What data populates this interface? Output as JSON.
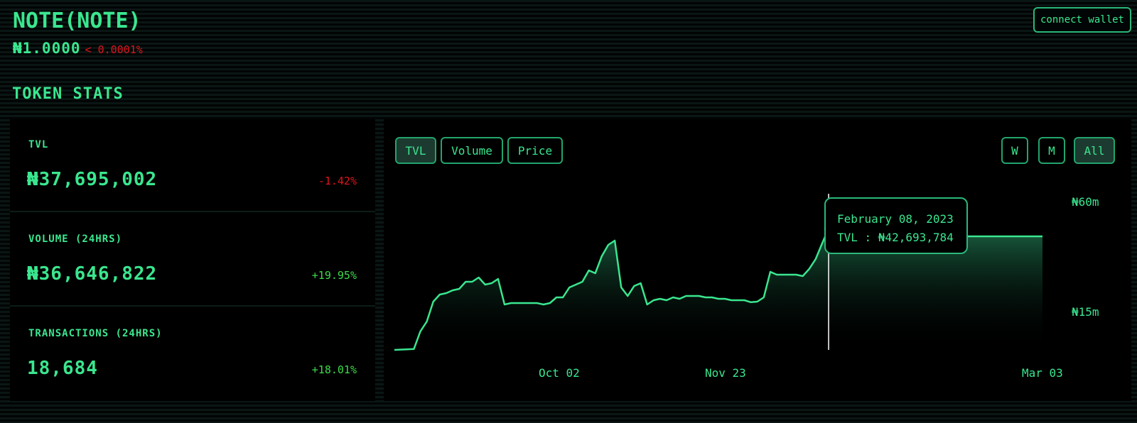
{
  "header": {
    "title": "NOTE(NOTE)",
    "price": "₦1.0000",
    "price_change": "< 0.0001%",
    "connect_label": "connect wallet"
  },
  "stats": {
    "heading": "TOKEN STATS",
    "items": [
      {
        "label": "TVL",
        "value": "₦37,695,002",
        "change": "-1.42%",
        "direction": "negative"
      },
      {
        "label": "VOLUME (24HRS)",
        "value": "₦36,646,822",
        "change": "+19.95%",
        "direction": "positive"
      },
      {
        "label": "TRANSACTIONS (24HRS)",
        "value": "18,684",
        "change": "+18.01%",
        "direction": "positive"
      }
    ]
  },
  "chart": {
    "metric_tabs": [
      {
        "label": "TVL",
        "active": true
      },
      {
        "label": "Volume",
        "active": false
      },
      {
        "label": "Price",
        "active": false
      }
    ],
    "range_tabs": [
      {
        "label": "W",
        "active": false
      },
      {
        "label": "M",
        "active": false
      },
      {
        "label": "All",
        "active": true
      }
    ],
    "tooltip": {
      "date": "February 08, 2023",
      "value_line": "TVL : ₦42,693,784"
    },
    "colors": {
      "line": "#3ae68f",
      "accent": "#3ae68f",
      "negative": "#e0141c",
      "positive": "#3ddb4a"
    }
  },
  "chart_data": {
    "type": "area",
    "series_name": "TVL",
    "x_tick_labels": [
      "Oct 02",
      "Nov 23",
      "Mar 03"
    ],
    "y_tick_labels": [
      "₦60m",
      "₦15m"
    ],
    "y_ticks": [
      60,
      15
    ],
    "ylim": [
      0,
      60
    ],
    "x": [
      0,
      3,
      4,
      5,
      6,
      7,
      8,
      9,
      10,
      11,
      12,
      13,
      14,
      15,
      16,
      17,
      18,
      19,
      20,
      21,
      22,
      23,
      24,
      25,
      26,
      27,
      28,
      29,
      30,
      31,
      32,
      33,
      34,
      35,
      36,
      37,
      38,
      39,
      40,
      41,
      42,
      43,
      44,
      45,
      46,
      47,
      48,
      49,
      50,
      51,
      52,
      53,
      54,
      55,
      56,
      57,
      58,
      59,
      60,
      61,
      62,
      63,
      64,
      65,
      66,
      67,
      68,
      69,
      70,
      71,
      72,
      73,
      74,
      75,
      76,
      77,
      78,
      79,
      80,
      81,
      82,
      83,
      84,
      85,
      86,
      87,
      88,
      89,
      90,
      91,
      92,
      93,
      94,
      95,
      96,
      97,
      98,
      99,
      100
    ],
    "values": [
      0,
      0.3,
      6.5,
      10,
      17,
      19.5,
      20,
      21,
      21.5,
      24,
      24,
      25.5,
      23,
      23.5,
      25,
      16,
      16.5,
      16.5,
      16.5,
      16.5,
      16.5,
      16,
      16.5,
      18.5,
      18.5,
      22,
      23,
      24,
      28,
      27,
      33,
      37,
      38.5,
      22,
      19,
      22.5,
      23.5,
      16,
      17.5,
      18,
      17.5,
      18.5,
      18,
      19,
      19,
      19,
      18.5,
      18.5,
      18,
      18,
      17.5,
      17.5,
      17.5,
      16.8,
      17,
      18.5,
      27.5,
      26.5,
      26.5,
      26.5,
      26.5,
      26,
      28.5,
      32,
      37.5,
      42.7,
      43,
      43,
      42.5,
      42.5,
      43,
      42.5,
      42,
      41.5,
      41,
      41,
      40.5,
      40,
      40,
      40,
      40,
      40,
      40,
      40,
      40,
      40,
      40,
      40,
      40,
      40,
      40,
      40,
      40,
      40,
      40,
      40,
      40,
      40,
      40
    ],
    "hover_point": {
      "date": "February 08, 2023",
      "value": 42.7
    }
  }
}
